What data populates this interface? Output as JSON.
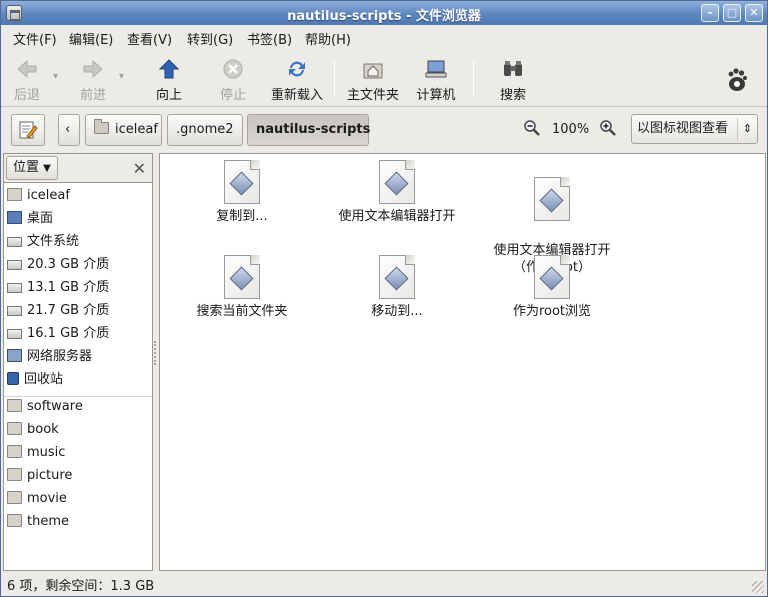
{
  "window": {
    "title": "nautilus-scripts - 文件浏览器"
  },
  "menu": [
    "文件(F)",
    "编辑(E)",
    "查看(V)",
    "转到(G)",
    "书签(B)",
    "帮助(H)"
  ],
  "toolbar": {
    "back": "后退",
    "forward": "前进",
    "up": "向上",
    "stop": "停止",
    "reload": "重新载入",
    "home": "主文件夹",
    "computer": "计算机",
    "search": "搜索"
  },
  "path": [
    "iceleaf",
    ".gnome2",
    "nautilus-scripts"
  ],
  "zoom": "100%",
  "view_mode": "以图标视图查看",
  "sidebar": {
    "header": "位置",
    "places": [
      {
        "label": "iceleaf",
        "icon": "home-folder-icon"
      },
      {
        "label": "桌面",
        "icon": "desktop-icon"
      },
      {
        "label": "文件系统",
        "icon": "filesystem-icon"
      },
      {
        "label": "20.3 GB 介质",
        "icon": "drive-icon"
      },
      {
        "label": "13.1 GB 介质",
        "icon": "drive-icon"
      },
      {
        "label": "21.7 GB 介质",
        "icon": "drive-icon"
      },
      {
        "label": "16.1 GB 介质",
        "icon": "drive-icon"
      },
      {
        "label": "网络服务器",
        "icon": "network-icon"
      },
      {
        "label": "回收站",
        "icon": "trash-icon"
      }
    ],
    "bookmarks": [
      "software",
      "book",
      "music",
      "picture",
      "movie",
      "theme"
    ]
  },
  "files": [
    {
      "label": "复制到..."
    },
    {
      "label": "使用文本编辑器打开"
    },
    {
      "label": "使用文本编辑器打开\n（作为root）"
    },
    {
      "label": "搜索当前文件夹"
    },
    {
      "label": "移动到..."
    },
    {
      "label": "作为root浏览"
    }
  ],
  "status": "6 项，剩余空间：1.3 GB"
}
